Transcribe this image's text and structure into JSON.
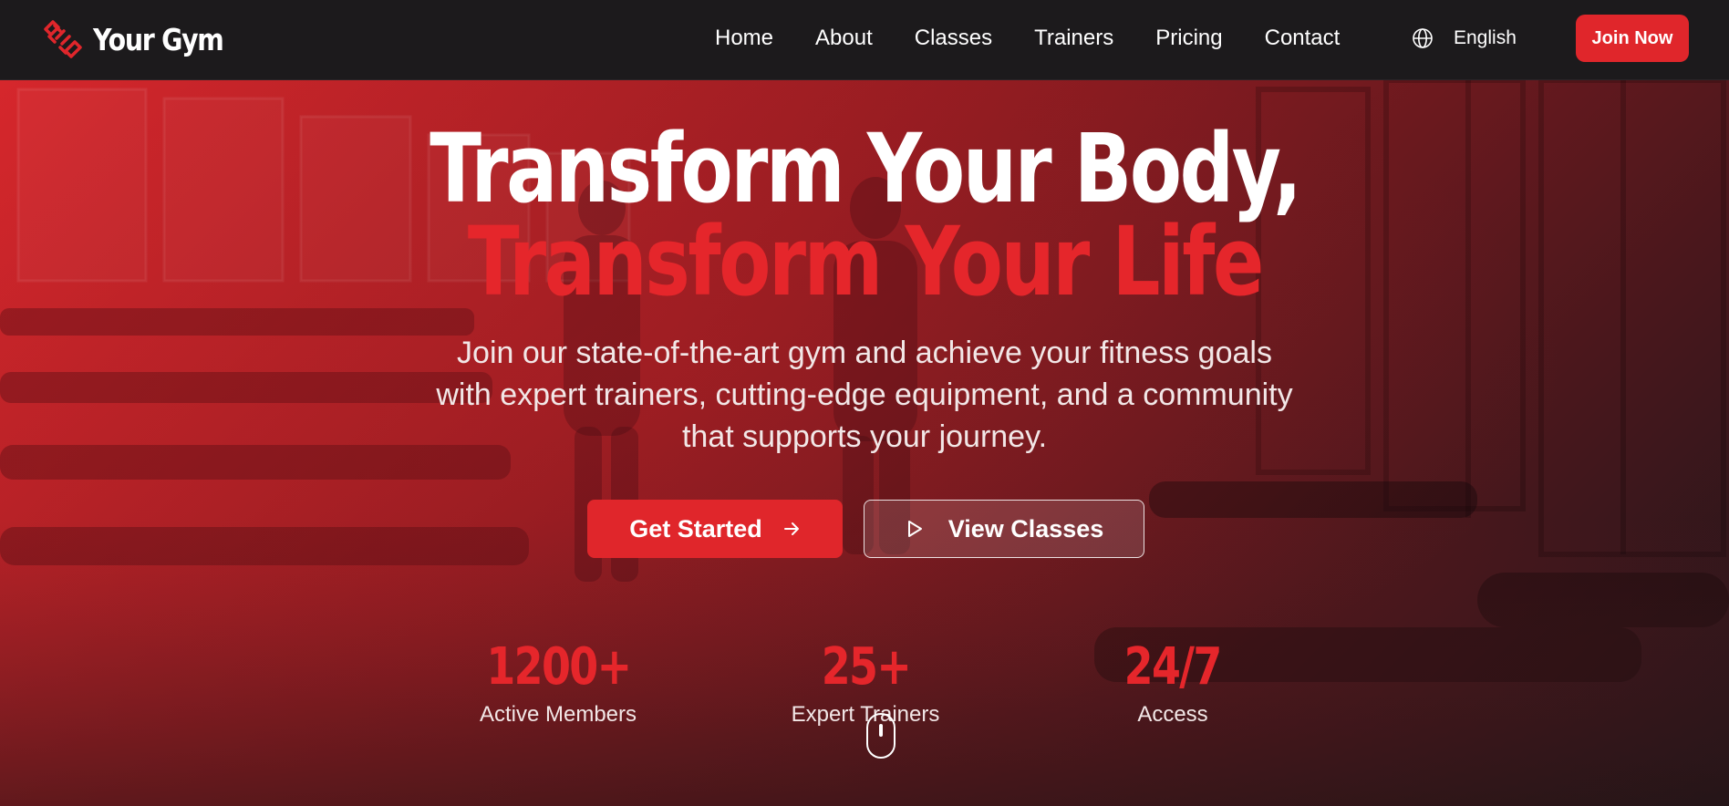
{
  "brand": {
    "name": "Your Gym",
    "accent": "#e0262b"
  },
  "nav": {
    "links": [
      "Home",
      "About",
      "Classes",
      "Trainers",
      "Pricing",
      "Contact"
    ],
    "language": "English",
    "join_label": "Join Now"
  },
  "hero": {
    "headline_line1": "Transform Your Body,",
    "headline_line2": "Transform Your Life",
    "subtitle": "Join our state-of-the-art gym and achieve your fitness goals with expert trainers, cutting-edge equipment, and a community that supports your journey.",
    "primary_cta": "Get Started",
    "secondary_cta": "View Classes"
  },
  "stats": [
    {
      "value": "1200+",
      "label": "Active Members"
    },
    {
      "value": "25+",
      "label": "Expert Trainers"
    },
    {
      "value": "24/7",
      "label": "Access"
    }
  ],
  "icons": {
    "logo": "dumbbell-icon",
    "language": "globe-icon",
    "primary_cta": "arrow-right-icon",
    "secondary_cta": "play-icon",
    "scroll": "mouse-scroll-icon"
  }
}
